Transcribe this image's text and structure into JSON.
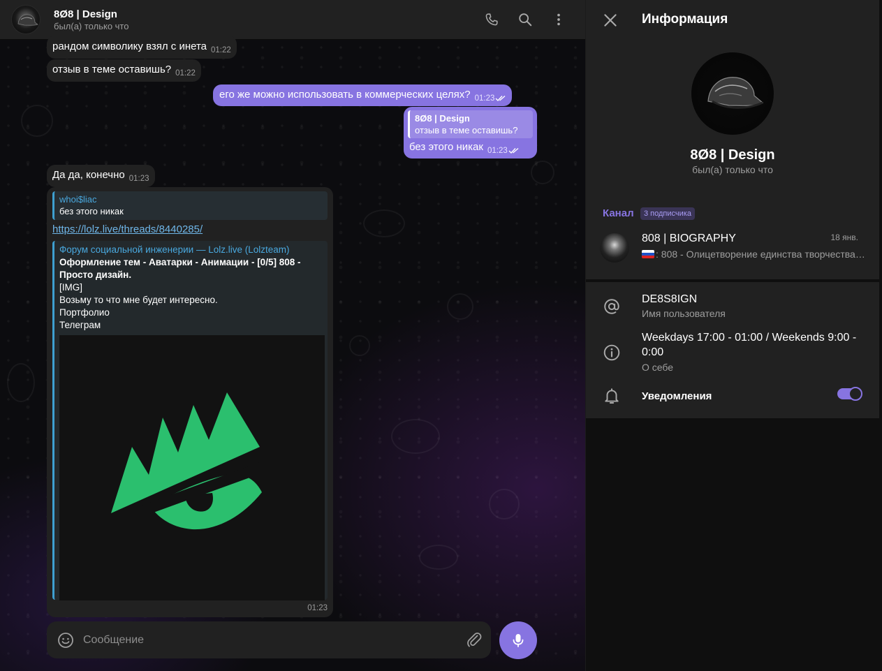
{
  "header": {
    "title": "8Ø8 | Design",
    "status": "был(а) только что"
  },
  "messages": {
    "m1": {
      "text": "рандом символику взял с инета",
      "time": "01:22"
    },
    "m2": {
      "text": "отзыв в теме оставишь?",
      "time": "01:22"
    },
    "m3": {
      "text": "его же можно использовать в коммерческих целях?",
      "time": "01:23"
    },
    "m4": {
      "reply_name": "8Ø8 | Design",
      "reply_text": "отзыв в теме оставишь?",
      "text": "без этого никак",
      "time": "01:23"
    },
    "m5": {
      "text": "Да да, конечно",
      "time": "01:23"
    },
    "m6": {
      "reply_name": "whoi$liac",
      "reply_text": "без этого никак",
      "link": "https://lolz.live/threads/8440285/",
      "preview_site": "Форум социальной инженерии — Lolz.live (Lolzteam)",
      "preview_title": "Оформление тем - Аватарки - Анимации - [0/5] 808 - Просто дизайн.",
      "preview_lines": [
        "[IMG]",
        "Возьму то что мне будет интересно.",
        "Портфолио",
        "Телеграм"
      ],
      "time": "01:23"
    }
  },
  "composer": {
    "placeholder": "Сообщение"
  },
  "info": {
    "title": "Информация",
    "name": "8Ø8 | Design",
    "status": "был(а) только что",
    "channel_label": "Канал",
    "channel_badge": "3 подписчика",
    "channel": {
      "name": "808 | BIOGRAPHY",
      "date": "18 янв.",
      "desc": ": 808 - Олицетворение единства творчества…"
    },
    "username": {
      "value": "DE8S8IGN",
      "label": "Имя пользователя"
    },
    "about": {
      "value": "Weekdays 17:00 - 01:00 / Weekends 9:00 - 0:00",
      "label": "О себе"
    },
    "notifications": {
      "label": "Уведомления",
      "enabled": true
    }
  },
  "colors": {
    "accent": "#8774e1",
    "incoming_bubble": "#212121",
    "link": "#6fb6e8",
    "logo_green": "#2bbf6e"
  },
  "icons": [
    "phone-icon",
    "search-icon",
    "more-vertical-icon",
    "close-icon",
    "at-icon",
    "info-icon",
    "bell-icon",
    "emoji-icon",
    "attach-icon",
    "mic-icon"
  ]
}
